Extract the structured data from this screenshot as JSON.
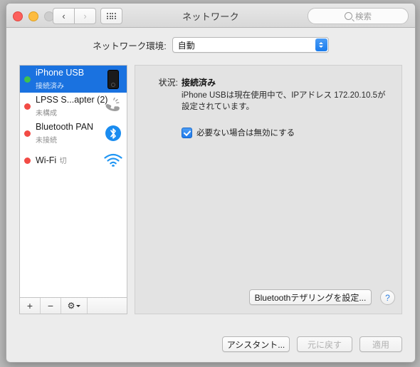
{
  "window": {
    "title": "ネットワーク",
    "traffic_lights": [
      "close",
      "minimize",
      "zoom"
    ],
    "nav": {
      "back": "‹",
      "forward": "›",
      "grid": "grid-icon"
    },
    "search": {
      "placeholder": "検索",
      "value": ""
    }
  },
  "environment": {
    "label": "ネットワーク環境:",
    "selected": "自動",
    "options": [
      "自動"
    ]
  },
  "sidebar": {
    "services": [
      {
        "name": "iPhone USB",
        "status": "接続済み",
        "dot": "green",
        "icon": "iphone-icon",
        "selected": true
      },
      {
        "name": "LPSS S...apter (2)",
        "status": "未構成",
        "dot": "red",
        "icon": "modem-icon",
        "selected": false
      },
      {
        "name": "Bluetooth PAN",
        "status": "未接続",
        "dot": "red",
        "icon": "bluetooth-icon",
        "selected": false
      },
      {
        "name": "Wi-Fi",
        "status": "切",
        "dot": "red",
        "icon": "wifi-icon",
        "selected": false
      }
    ],
    "toolbar": {
      "add": "+",
      "remove": "−",
      "actions": "gear-icon"
    }
  },
  "panel": {
    "status_label": "状況:",
    "status_value": "接続済み",
    "description": "iPhone USBは現在使用中で、IPアドレス 172.20.10.5が設定されています。",
    "ip_address": "172.20.10.5",
    "checkbox": {
      "label": "必要ない場合は無効にする",
      "checked": true
    },
    "tethering_button": "Bluetoothテザリングを設定...",
    "help_button": "?"
  },
  "footer": {
    "assistant": "アシスタント...",
    "revert": "元に戻す",
    "apply": "適用",
    "revert_enabled": false,
    "apply_enabled": false
  },
  "colors": {
    "accent": "#1a72e0",
    "connected": "#3fc14e",
    "disconnected": "#f24b45",
    "bluetooth": "#1a8cf0",
    "wifi": "#2196f3"
  }
}
